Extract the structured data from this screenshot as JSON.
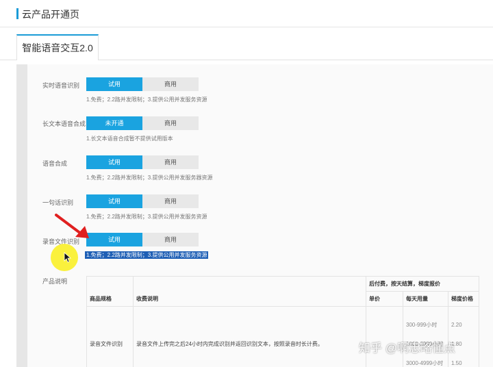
{
  "header": {
    "title": "云产品开通页"
  },
  "tabs": [
    {
      "label": "智能语音交互2.0"
    }
  ],
  "rows": [
    {
      "label": "实时语音识别",
      "primary": "试用",
      "secondary": "商用",
      "note": "1.免费；2.2路并发限制；3.提供公用并发服务资源"
    },
    {
      "label": "长文本语音合成",
      "primary": "未开通",
      "secondary": "商用",
      "note": "1.长文本语音合成暂不提供试用版本"
    },
    {
      "label": "语音合成",
      "primary": "试用",
      "secondary": "商用",
      "note": "1.免费；2.2路并发限制；3.提供公用并发服务器资源"
    },
    {
      "label": "一句话识别",
      "primary": "试用",
      "secondary": "商用",
      "note": "1.免费；2.2路并发限制；3.提供公用并发服务资源"
    },
    {
      "label": "录音文件识别",
      "primary": "试用",
      "secondary": "商用",
      "note": "1.免费；2.2路并发限制；3.提供公用并发服务资源"
    }
  ],
  "product": {
    "label": "产品说明",
    "billing_header": "后付费，按天结算，梯度报价",
    "columns": {
      "spec": "商品规格",
      "desc": "收费说明",
      "unit": "单价",
      "daily": "每天用量",
      "tier_price": "梯度价格"
    },
    "item": {
      "spec": "录音文件识别",
      "desc": "录音文件上传完之后24小时内完成识别并返回识别文本，按照录音时长计费。"
    },
    "tiers": [
      {
        "range": "300-999小时",
        "price": "2.20"
      },
      {
        "range": "1000-2999小时",
        "price": "1.80"
      },
      {
        "range": "3000-4999小时",
        "price": "1.50"
      }
    ]
  },
  "watermark": "知乎 @啊忠略懂点",
  "colors": {
    "accent": "#1aa3e0",
    "selection": "#1e5fb5",
    "arrow": "#e02020",
    "cursor_highlight": "#faf028"
  }
}
